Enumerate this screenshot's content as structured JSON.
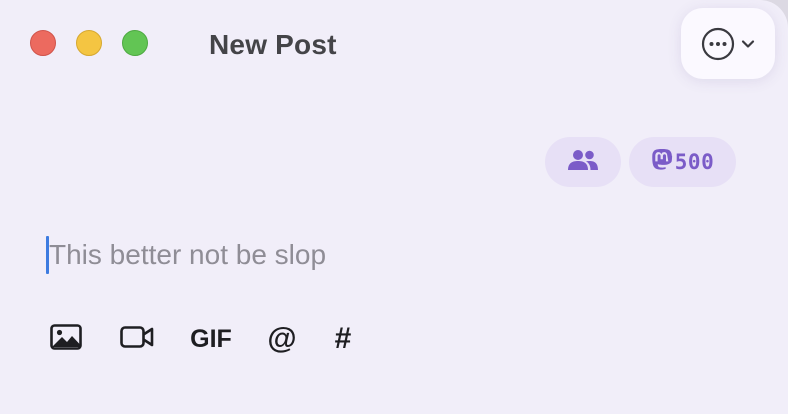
{
  "window": {
    "title": "New Post"
  },
  "header": {
    "more_menu_icon": "ellipsis-circle-icon",
    "chevron_icon": "chevron-down-icon"
  },
  "chips": {
    "audience_icon": "people-icon",
    "account_icon": "mastodon-icon",
    "char_count": "500"
  },
  "composer": {
    "placeholder": "This better not be slop",
    "value": ""
  },
  "toolbar": {
    "image_icon": "image-icon",
    "video_icon": "video-camera-icon",
    "gif_label": "GIF",
    "mention_label": "@",
    "hashtag_label": "#"
  },
  "colors": {
    "background": "#f1eef9",
    "accent": "#7b5cc8",
    "chip_bg": "#e7e0f6",
    "caret": "#3d7be0"
  }
}
